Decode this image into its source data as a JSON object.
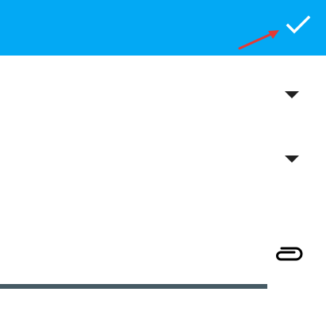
{
  "colors": {
    "toolbar_background": "#03A9F4",
    "page_background": "#FFFFFF",
    "check_icon": "#FFFFFF",
    "hint_arrow": "#E53935",
    "dropdown_icon": "#212121",
    "attach_icon": "#000000",
    "progress_fill": "#455A64"
  },
  "icons": {
    "confirm": "check-icon",
    "dropdowns": [
      "caret-down-icon",
      "caret-down-icon"
    ],
    "attach": "paperclip-icon",
    "hint": "red-arrow-icon"
  },
  "progress": {
    "fraction": 0.82
  }
}
